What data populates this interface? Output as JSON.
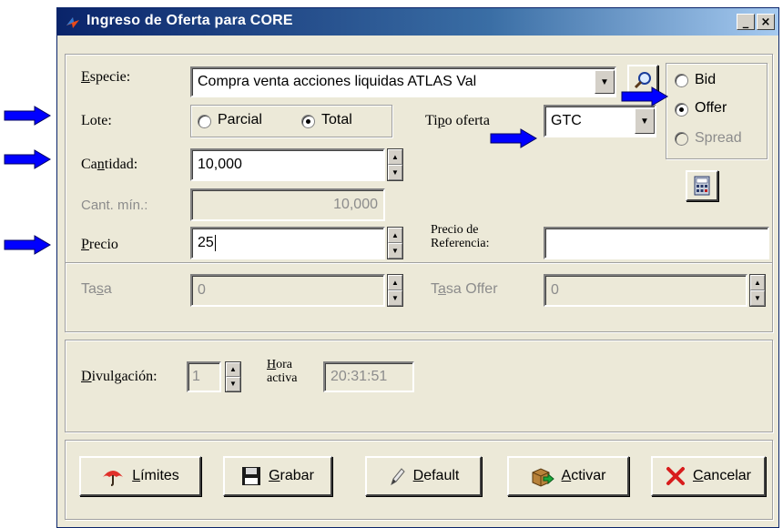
{
  "window": {
    "title": "Ingreso de Oferta para CORE",
    "minimize_label": "_",
    "close_label": "×"
  },
  "form": {
    "especie": {
      "label": "Especie:",
      "value": "Compra venta acciones liquidas ATLAS Val"
    },
    "lote": {
      "label": "Lote:",
      "options": [
        "Parcial",
        "Total"
      ],
      "selected": "Total"
    },
    "tipo_oferta": {
      "label": "Tipo oferta",
      "value": "GTC"
    },
    "side": {
      "options": [
        "Bid",
        "Offer",
        "Spread"
      ],
      "selected": "Offer"
    },
    "cantidad": {
      "label": "Cantidad:",
      "value": "10,000"
    },
    "cant_min": {
      "label": "Cant. mín.:",
      "value": "10,000"
    },
    "precio": {
      "label": "Precio",
      "value": "25"
    },
    "precio_referencia": {
      "label_line1": "Precio de",
      "label_line2": "Referencia:",
      "value": ""
    },
    "tasa": {
      "label": "Tasa",
      "value": "0"
    },
    "tasa_offer": {
      "label": "Tasa Offer",
      "value": "0"
    }
  },
  "divulgacion": {
    "label": "Divulgación:",
    "value": "1",
    "hora_label_line1": "Hora",
    "hora_label_line2": "activa",
    "hora_value": "20:31:51"
  },
  "buttons": {
    "limites": "Límites",
    "grabar": "Grabar",
    "default": "Default",
    "activar": "Activar",
    "cancelar": "Cancelar"
  },
  "icons": {
    "title": "app-icon",
    "search": "magnifier-icon",
    "calculator": "calculator-icon",
    "limites": "umbrella-icon",
    "grabar": "floppy-icon",
    "default": "pen-icon",
    "activar": "box-arrow-icon",
    "cancelar": "x-icon",
    "annotation": "blue-arrow-icon"
  },
  "colors": {
    "titlebar_start": "#0a246a",
    "titlebar_end": "#a6caf0",
    "window_bg": "#ece9d8",
    "annotation_arrow": "#0000ff"
  }
}
